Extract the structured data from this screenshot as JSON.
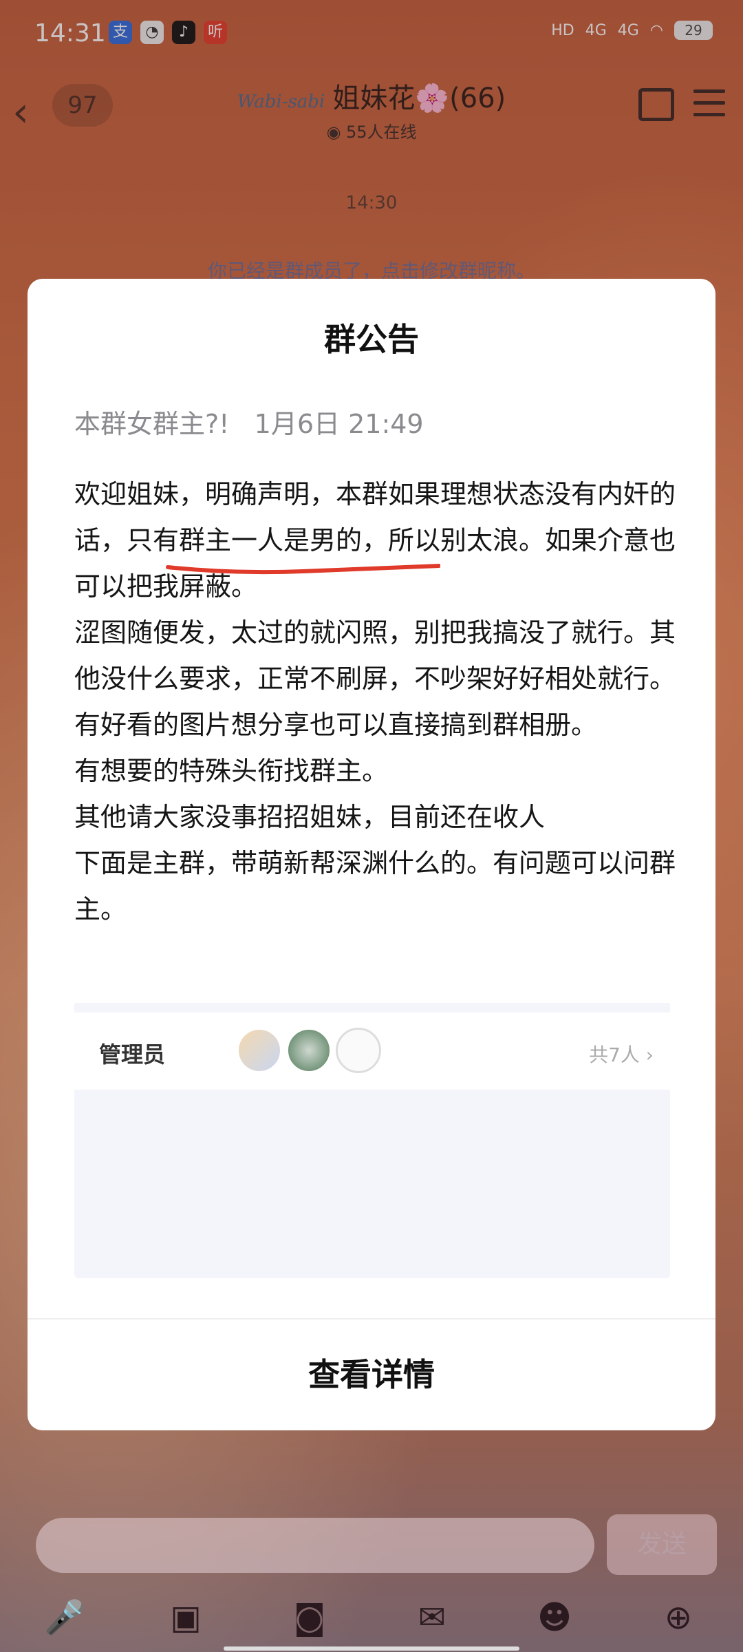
{
  "status_bar": {
    "time": "14:31",
    "apps": [
      "支",
      "◔",
      "♪",
      "听"
    ],
    "signal_labels": [
      "HD",
      "4G",
      "4G"
    ],
    "battery": "29"
  },
  "header": {
    "back_icon": "chevron-left-icon",
    "unread_count": "97",
    "logo_text": "Wabi-sabi",
    "group_name": "姐妹花🌸(66)",
    "online": "55人在线"
  },
  "chat": {
    "time": "14:30",
    "system_message": "你已经是群成员了，点击修改群昵称。"
  },
  "announcement": {
    "title": "群公告",
    "author": "本群女群主?!",
    "date": "1月6日 21:49",
    "paragraphs": [
      "欢迎姐妹，明确声明，本群如果理想状态没有内奸的话，只有群主一人是男的，所以别太浪。如果介意也可以把我屏蔽。",
      "涩图随便发，太过的就闪照，别把我搞没了就行。其他没什么要求，正常不刷屏，不吵架好好相处就行。",
      "有好看的图片想分享也可以直接搞到群相册。",
      "有想要的特殊头衔找群主。",
      "其他请大家没事招招姐妹，目前还在收人",
      "下面是主群，带萌新帮深渊什么的。有问题可以问群主。"
    ],
    "admin_label": "管理员",
    "admin_count": "共7人 ›",
    "view_details": "查看详情"
  },
  "composer": {
    "send_label": "发送",
    "tools": [
      "mic-icon",
      "image-icon",
      "camera-icon",
      "red-packet-icon",
      "emoji-icon",
      "plus-icon"
    ]
  },
  "colors": {
    "background": "#d57145",
    "dialog": "#ffffff",
    "underline": "#e03a2a",
    "meta_text": "#8a8a8f"
  }
}
